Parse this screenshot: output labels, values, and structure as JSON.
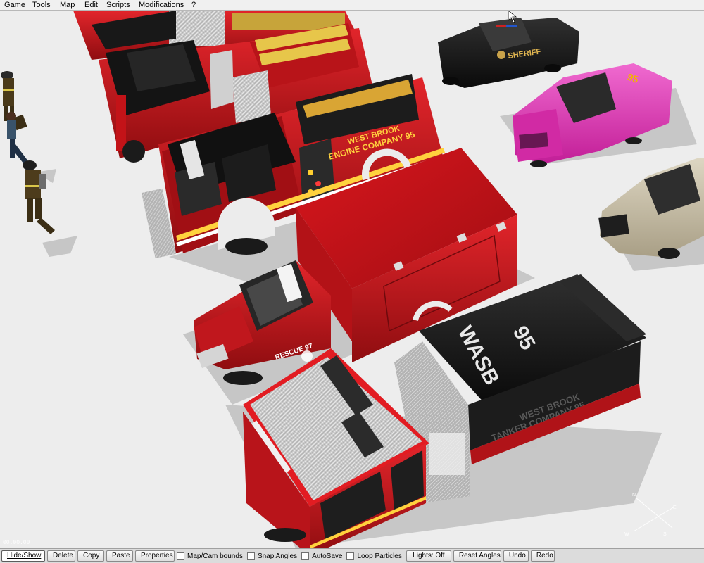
{
  "menu": {
    "items": [
      "Game",
      "Tools",
      "Map",
      "Edit",
      "Scripts",
      "Modifications",
      "?"
    ]
  },
  "viewport": {
    "coord_readout": "00.00.00",
    "compass_labels": {
      "n": "N",
      "e": "E",
      "s": "S",
      "w": "W"
    },
    "vehicle_text": {
      "engine_company_line1": "WEST BROOK",
      "engine_company_line2": "ENGINE COMPANY 95",
      "rescue_label": "RESCUE 97",
      "tanker_roof_text": "WASB",
      "tanker_roof_number": "95",
      "tanker_company_line1": "WEST BROOK",
      "tanker_company_line2": "TANKER COMPANY 95",
      "sheriff_label": "SHERIFF",
      "pink_suv_number": "95"
    }
  },
  "toolbar": {
    "hide_show": "Hide/Show",
    "delete": "Delete",
    "copy": "Copy",
    "paste": "Paste",
    "properties": "Properties",
    "map_cam_bounds": "Map/Cam bounds",
    "snap_angles": "Snap Angles",
    "autosave": "AutoSave",
    "loop_particles": "Loop Particles",
    "lights": "Lights: Off",
    "reset_angles": "Reset Angles",
    "undo": "Undo",
    "redo": "Redo"
  },
  "colors": {
    "fire_red": "#c0141a",
    "dark_red": "#7a0a0c",
    "black_body": "#151515",
    "pink_body": "#e436b8",
    "tan_body": "#c8bfa6",
    "diamond_plate": "#c9c9c9",
    "yellow_stripe": "#f2c230"
  }
}
